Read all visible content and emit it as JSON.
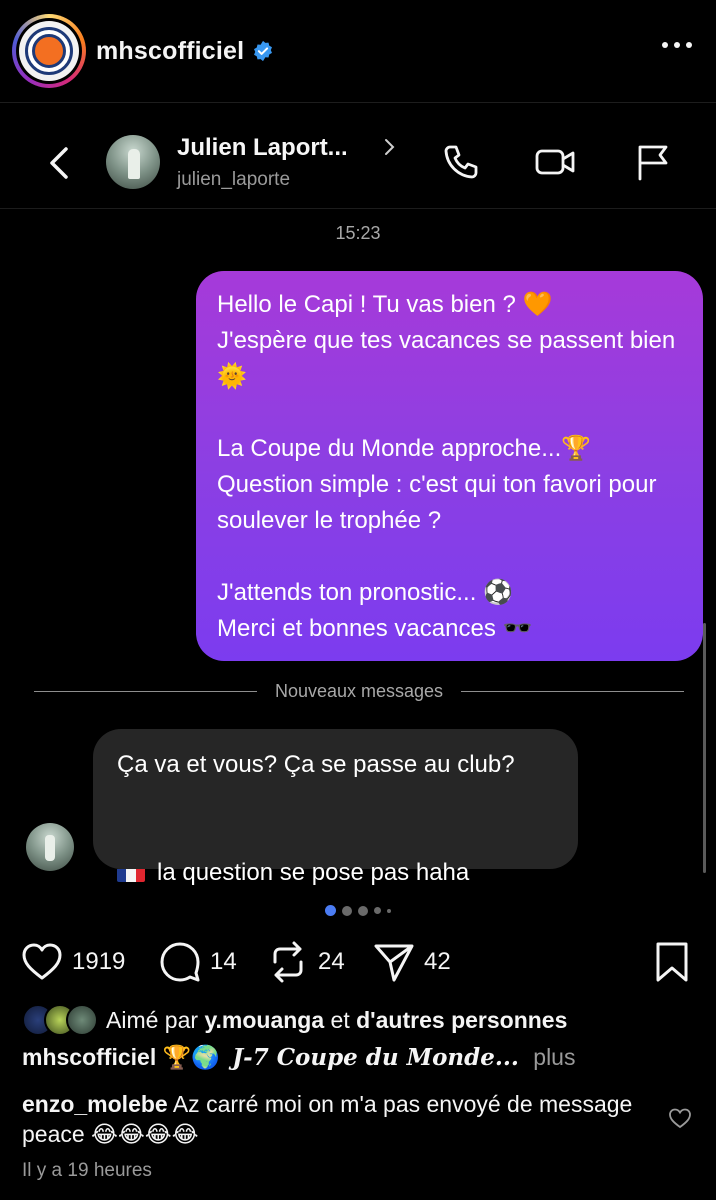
{
  "post": {
    "username": "mhscofficiel",
    "verified": true
  },
  "dm": {
    "contact_name": "Julien Laport...",
    "contact_handle": "julien_laporte",
    "timestamp": "15:23",
    "outgoing_message": "Hello le Capi ! Tu vas bien ? 🧡\nJ'espère que tes vacances se passent bien 🌞\n\nLa Coupe du Monde approche...🏆\nQuestion simple : c'est qui ton favori pour soulever le trophée ?\n\nJ'attends ton pronostic... ⚽\nMerci et bonnes vacances 🕶️",
    "divider_label": "Nouveaux messages",
    "incoming_line1": "Ça va et vous? Ça se passe au club?",
    "incoming_line2": "la question se pose pas haha"
  },
  "carousel": {
    "dot_count": 5,
    "active_index": 0
  },
  "actions": {
    "likes": "1919",
    "comments": "14",
    "reposts": "24",
    "shares": "42"
  },
  "liked_by": {
    "prefix": "Aimé par",
    "user": "y.mouanga",
    "connector": "et",
    "others": "d'autres personnes"
  },
  "caption": {
    "username": "mhscofficiel",
    "emojis": "🏆🌍",
    "text": "J-7 Coupe du Monde...",
    "more": "plus"
  },
  "comment": {
    "username": "enzo_molebe",
    "text": "Az carré moi on m'a pas envoyé de message peace 😂😂😂😂"
  },
  "time_ago": "Il y a 19 heures",
  "colors": {
    "accent_verified": "#3897f0",
    "bubble_gradient_top": "#a63ad9",
    "bubble_gradient_bottom": "#7c3cef",
    "incoming_bubble": "#262626",
    "dot_active": "#4b7cf3"
  }
}
